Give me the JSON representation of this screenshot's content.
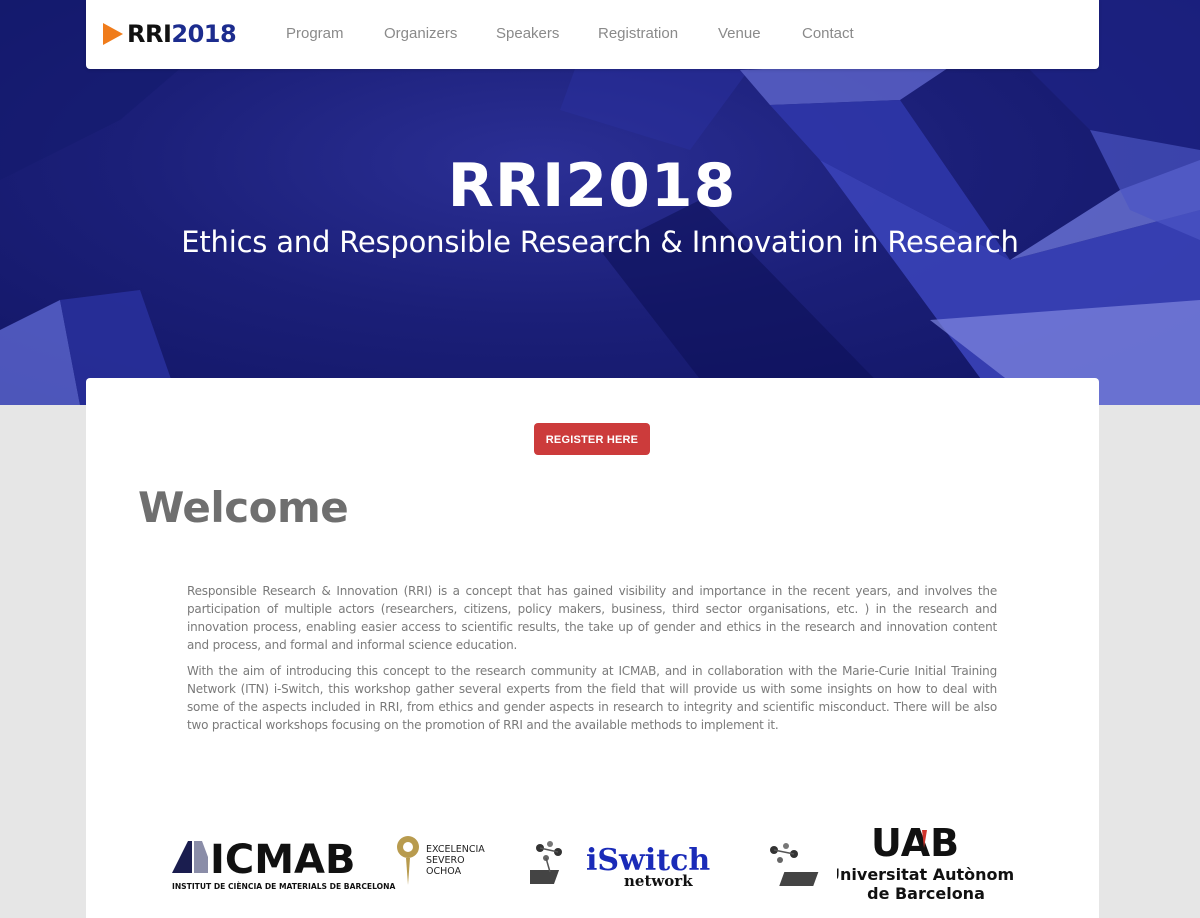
{
  "nav": {
    "logo_prefix": "RRI",
    "logo_year": "2018",
    "links": [
      "Program",
      "Organizers",
      "Speakers",
      "Registration",
      "Venue",
      "Contact"
    ]
  },
  "hero": {
    "title": "RRI2018",
    "subtitle": "Ethics and Responsible Research & Innovation in Research"
  },
  "main": {
    "register_label": "REGISTER HERE",
    "heading": "Welcome",
    "paragraphs": [
      "Responsible Research & Innovation (RRI) is a concept that has gained visibility and importance in the recent years, and involves the participation of multiple actors (researchers, citizens, policy makers, business, third sector organisations, etc. ) in the research and innovation process, enabling easier access to scientific results, the take up of gender and ethics in the research and innovation content and process, and formal and informal science education.",
      "With the aim of introducing this concept to the research community at ICMAB, and in collaboration with the Marie-Curie Initial Training Network (ITN) i-Switch, this workshop gather several experts from the field that will provide us with some insights on how to deal with some of the aspects included in RRI, from ethics and gender aspects in research to integrity and scientific misconduct. There will be also two practical workshops focusing on the promotion of RRI and the available methods to implement it."
    ]
  },
  "sponsors": {
    "icmab": {
      "name": "ICMAB",
      "caption": "INSTITUT DE CIÈNCIA DE MATERIALS DE BARCELONA",
      "badge_lines": [
        "EXCELENCIA",
        "SEVERO",
        "OCHOA"
      ]
    },
    "iswitch": {
      "name": "iSwitch",
      "sub": "network"
    },
    "uab": {
      "name": "UAB",
      "line1": "Universitat Autònoma",
      "line2": "de Barcelona"
    }
  },
  "colors": {
    "logo_orange": "#f07c1b",
    "logo_blue": "#1c2c8e",
    "register_red": "#cc3b3b",
    "hero_blue": "#1b1f78"
  }
}
